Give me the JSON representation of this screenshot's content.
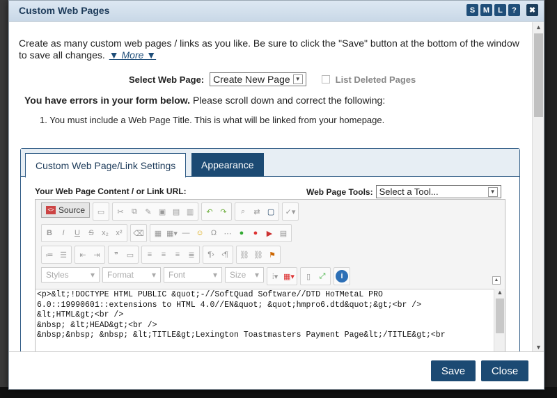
{
  "modal": {
    "title": "Custom Web Pages",
    "header_buttons": [
      "S",
      "M",
      "L",
      "?"
    ],
    "close_glyph": "✖"
  },
  "intro": {
    "text": "Create as many custom web pages / links as you like. Be sure to click the \"Save\" button at the bottom of the window to save all changes.",
    "more_label": "▼ More ▼"
  },
  "select_page": {
    "label": "Select Web Page:",
    "value": "Create New Page",
    "list_deleted_label": "List Deleted Pages"
  },
  "errors": {
    "heading_bold": "You have errors in your form below.",
    "heading_rest": " Please scroll down and correct the following:",
    "items": [
      "1. You must include a Web Page Title. This is what will be linked from your homepage."
    ]
  },
  "tabs": {
    "active": "Custom Web Page/Link Settings",
    "inactive": "Appearance"
  },
  "content": {
    "label": "Your Web Page Content / or Link URL:",
    "tools_label": "Web Page Tools:",
    "tools_value": "Select a Tool..."
  },
  "editor": {
    "source_label": "Source",
    "combos": [
      "Styles",
      "Format",
      "Font",
      "Size"
    ],
    "code": "<p>&lt;!DOCTYPE HTML PUBLIC &quot;-//SoftQuad Software//DTD HoTMetaL PRO\n6.0::19990601::extensions to HTML 4.0//EN&quot; &quot;hmpro6.dtd&quot;&gt;<br />\n&lt;HTML&gt;<br />\n&nbsp; &lt;HEAD&gt;<br />\n&nbsp;&nbsp; &nbsp; &lt;TITLE&gt;Lexington Toastmasters Payment Page&lt;/TITLE&gt;<br"
  },
  "footer": {
    "save_label": "Save",
    "close_label": "Close"
  },
  "colors": {
    "accent": "#1c4a73",
    "header_bg": "#c9d8e7"
  }
}
